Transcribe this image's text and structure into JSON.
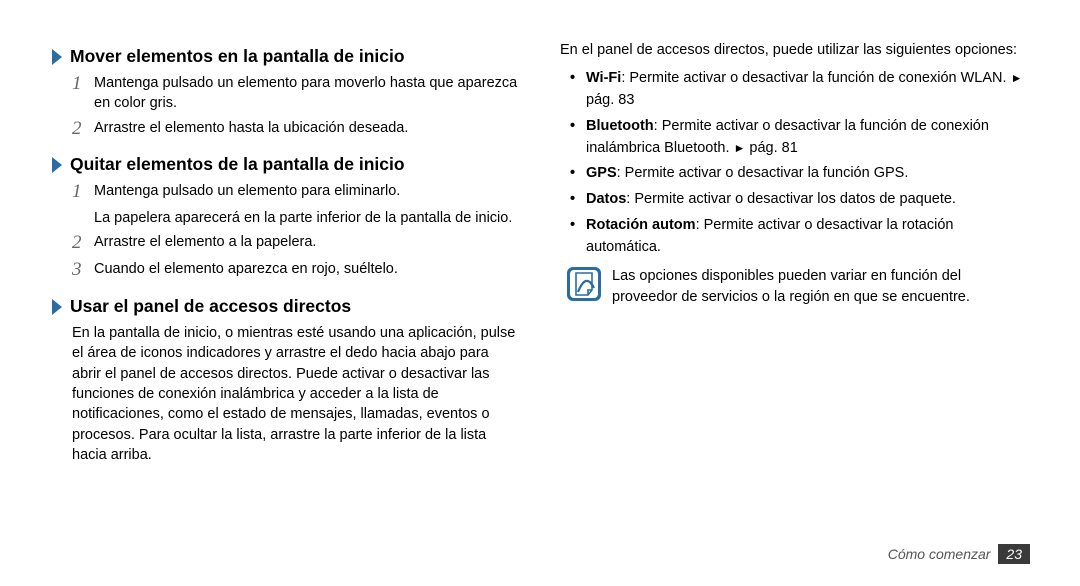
{
  "left": {
    "heading1": "Mover elementos en la pantalla de inicio",
    "step1_1": "Mantenga pulsado un elemento para moverlo hasta que aparezca en color gris.",
    "step1_2": "Arrastre el elemento hasta la ubicación deseada.",
    "heading2": "Quitar elementos de la pantalla de inicio",
    "step2_1": "Mantenga pulsado un elemento para eliminarlo.",
    "step2_1_sub": "La papelera aparecerá en la parte inferior de la pantalla de inicio.",
    "step2_2": "Arrastre el elemento a la papelera.",
    "step2_3": "Cuando el elemento aparezca en rojo, suéltelo.",
    "heading3": "Usar el panel de accesos directos",
    "para3": "En la pantalla de inicio, o mientras esté usando una aplicación, pulse el área de iconos indicadores y arrastre el dedo hacia abajo para abrir el panel de accesos directos. Puede activar o desactivar las funciones de conexión inalámbrica y acceder a la lista de notificaciones, como el estado de mensajes, llamadas, eventos o procesos. Para ocultar la lista, arrastre la parte inferior de la lista hacia arriba."
  },
  "right": {
    "intro": "En el panel de accesos directos, puede utilizar las siguientes opciones:",
    "bullets": {
      "wifi_bold": "Wi-Fi",
      "wifi_rest": ": Permite activar o desactivar la función de conexión WLAN. ",
      "wifi_page": " pág. 83",
      "bt_bold": "Bluetooth",
      "bt_rest": ": Permite activar o desactivar la función de conexión inalámbrica Bluetooth. ",
      "bt_page": " pág. 81",
      "gps_bold": "GPS",
      "gps_rest": ": Permite activar o desactivar la función GPS.",
      "datos_bold": "Datos",
      "datos_rest": ": Permite activar o desactivar los datos de paquete.",
      "rot_bold": "Rotación autom",
      "rot_rest": ": Permite activar o desactivar la rotación automática."
    },
    "note": "Las opciones disponibles pueden variar en función del proveedor de servicios o la región en que se encuentre."
  },
  "footer": {
    "label": "Cómo comenzar",
    "page": "23"
  },
  "numbers": {
    "n1": "1",
    "n2": "2",
    "n3": "3"
  },
  "bullet_char": "•",
  "arrow_char": "►"
}
